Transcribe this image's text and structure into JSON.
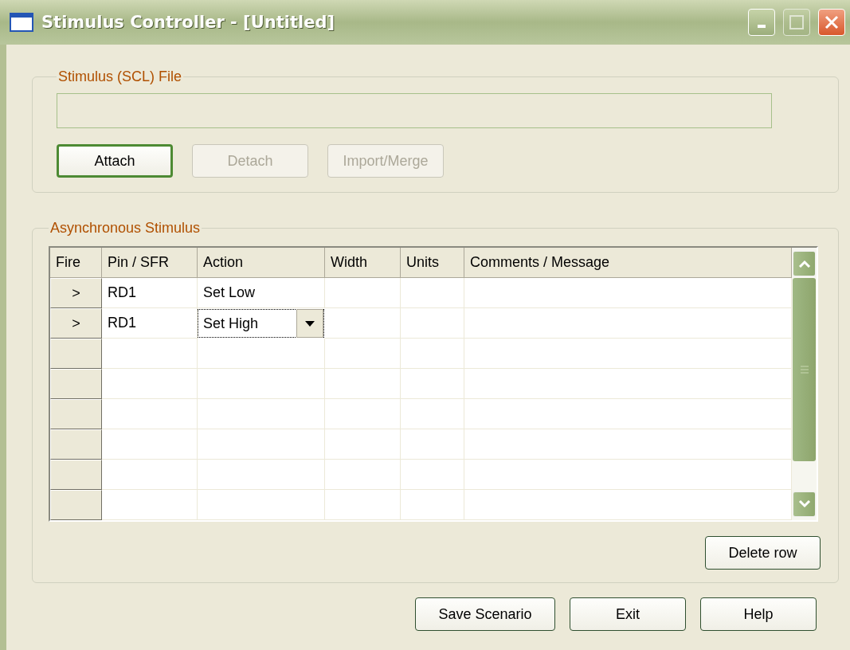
{
  "window": {
    "title": "Stimulus Controller - [Untitled]"
  },
  "file_group": {
    "title": "Stimulus (SCL)  File",
    "buttons": [
      {
        "label": "Attach",
        "disabled": false,
        "default": true
      },
      {
        "label": "Detach",
        "disabled": true,
        "default": false
      },
      {
        "label": "Import/Merge",
        "disabled": true,
        "default": false
      }
    ]
  },
  "async_group": {
    "title": "Asynchronous Stimulus",
    "table": {
      "columns": [
        "Fire",
        "Pin / SFR",
        "Action",
        "Width",
        "Units",
        "Comments / Message"
      ],
      "rows": [
        {
          "fire": ">",
          "pin": "RD1",
          "action": "Set Low",
          "editing": false
        },
        {
          "fire": ">",
          "pin": "RD1",
          "action": "Set High",
          "editing": true
        }
      ]
    },
    "delete_button": "Delete row"
  },
  "buttons": [
    "Save Scenario",
    "Exit",
    "Help"
  ]
}
